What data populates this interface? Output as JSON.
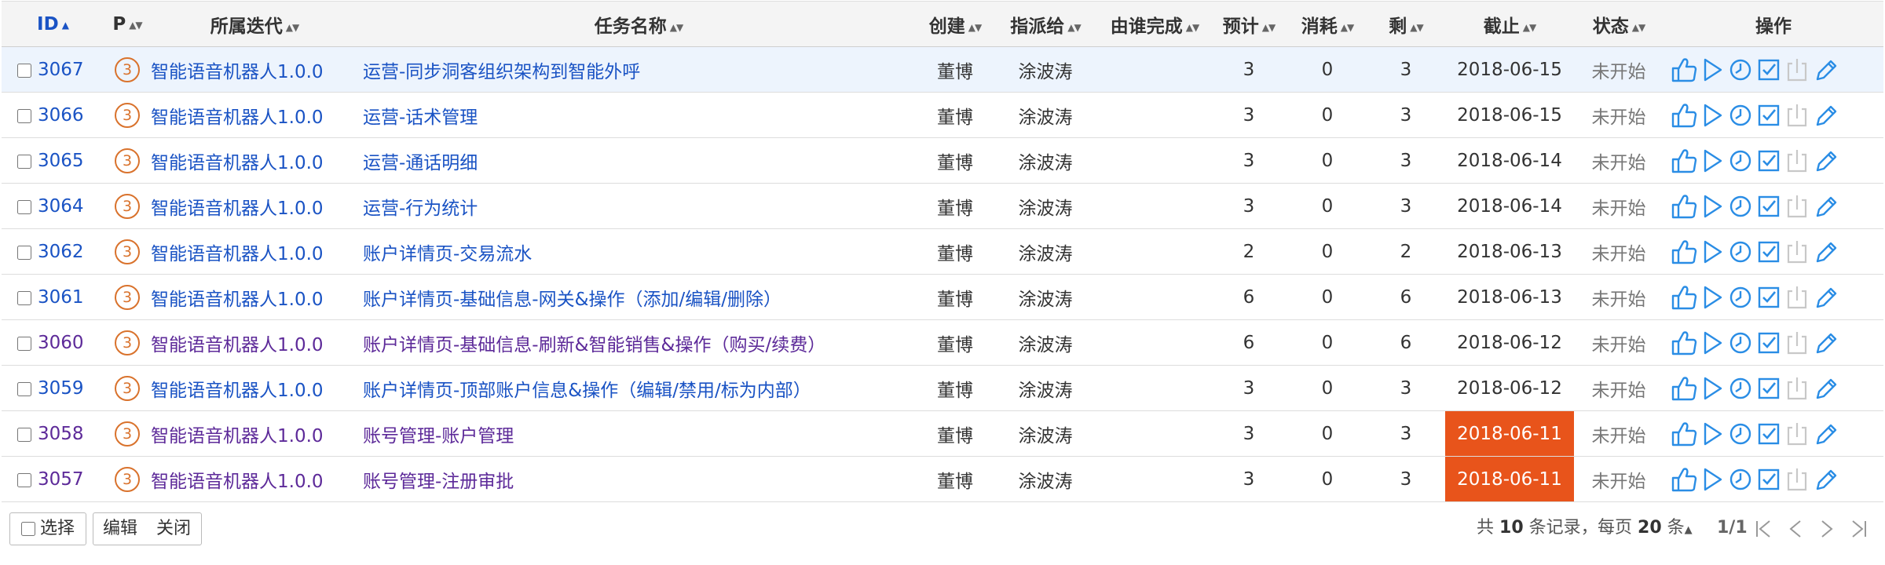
{
  "colors": {
    "link": "#1a53c4",
    "link_visited": "#5d2a99",
    "priority": "#d9722c",
    "overdue": "#e8541b",
    "icon": "#2a8de5",
    "icon_disabled": "#c8c8c8",
    "row_highlight": "#edf4fd"
  },
  "headers": {
    "id": "ID",
    "pri": "P",
    "iteration": "所属迭代",
    "name": "任务名称",
    "creator": "创建",
    "assignee": "指派给",
    "finisher": "由谁完成",
    "estimate": "预计",
    "consumed": "消耗",
    "left": "剩",
    "deadline": "截止",
    "status": "状态",
    "actions": "操作"
  },
  "rows": [
    {
      "id": "3067",
      "pri": "3",
      "iteration": "智能语音机器人1.0.0",
      "name": "运营-同步洞客组织架构到智能外呼",
      "creator": "董博",
      "assignee": "涂波涛",
      "finisher": "",
      "estimate": "3",
      "consumed": "0",
      "left": "3",
      "deadline": "2018-06-15",
      "status": "未开始",
      "overdue": false,
      "visited": false,
      "highlight": true
    },
    {
      "id": "3066",
      "pri": "3",
      "iteration": "智能语音机器人1.0.0",
      "name": "运营-话术管理",
      "creator": "董博",
      "assignee": "涂波涛",
      "finisher": "",
      "estimate": "3",
      "consumed": "0",
      "left": "3",
      "deadline": "2018-06-15",
      "status": "未开始",
      "overdue": false,
      "visited": false,
      "highlight": false
    },
    {
      "id": "3065",
      "pri": "3",
      "iteration": "智能语音机器人1.0.0",
      "name": "运营-通话明细",
      "creator": "董博",
      "assignee": "涂波涛",
      "finisher": "",
      "estimate": "3",
      "consumed": "0",
      "left": "3",
      "deadline": "2018-06-14",
      "status": "未开始",
      "overdue": false,
      "visited": false,
      "highlight": false
    },
    {
      "id": "3064",
      "pri": "3",
      "iteration": "智能语音机器人1.0.0",
      "name": "运营-行为统计",
      "creator": "董博",
      "assignee": "涂波涛",
      "finisher": "",
      "estimate": "3",
      "consumed": "0",
      "left": "3",
      "deadline": "2018-06-14",
      "status": "未开始",
      "overdue": false,
      "visited": false,
      "highlight": false
    },
    {
      "id": "3062",
      "pri": "3",
      "iteration": "智能语音机器人1.0.0",
      "name": "账户详情页-交易流水",
      "creator": "董博",
      "assignee": "涂波涛",
      "finisher": "",
      "estimate": "2",
      "consumed": "0",
      "left": "2",
      "deadline": "2018-06-13",
      "status": "未开始",
      "overdue": false,
      "visited": false,
      "highlight": false
    },
    {
      "id": "3061",
      "pri": "3",
      "iteration": "智能语音机器人1.0.0",
      "name": "账户详情页-基础信息-网关&操作（添加/编辑/删除）",
      "creator": "董博",
      "assignee": "涂波涛",
      "finisher": "",
      "estimate": "6",
      "consumed": "0",
      "left": "6",
      "deadline": "2018-06-13",
      "status": "未开始",
      "overdue": false,
      "visited": false,
      "highlight": false
    },
    {
      "id": "3060",
      "pri": "3",
      "iteration": "智能语音机器人1.0.0",
      "name": "账户详情页-基础信息-刷新&智能销售&操作（购买/续费）",
      "creator": "董博",
      "assignee": "涂波涛",
      "finisher": "",
      "estimate": "6",
      "consumed": "0",
      "left": "6",
      "deadline": "2018-06-12",
      "status": "未开始",
      "overdue": false,
      "visited": true,
      "highlight": false
    },
    {
      "id": "3059",
      "pri": "3",
      "iteration": "智能语音机器人1.0.0",
      "name": "账户详情页-顶部账户信息&操作（编辑/禁用/标为内部）",
      "creator": "董博",
      "assignee": "涂波涛",
      "finisher": "",
      "estimate": "3",
      "consumed": "0",
      "left": "3",
      "deadline": "2018-06-12",
      "status": "未开始",
      "overdue": false,
      "visited": false,
      "highlight": false
    },
    {
      "id": "3058",
      "pri": "3",
      "iteration": "智能语音机器人1.0.0",
      "name": "账号管理-账户管理",
      "creator": "董博",
      "assignee": "涂波涛",
      "finisher": "",
      "estimate": "3",
      "consumed": "0",
      "left": "3",
      "deadline": "2018-06-11",
      "status": "未开始",
      "overdue": true,
      "visited": true,
      "highlight": false
    },
    {
      "id": "3057",
      "pri": "3",
      "iteration": "智能语音机器人1.0.0",
      "name": "账号管理-注册审批",
      "creator": "董博",
      "assignee": "涂波涛",
      "finisher": "",
      "estimate": "3",
      "consumed": "0",
      "left": "3",
      "deadline": "2018-06-11",
      "status": "未开始",
      "overdue": true,
      "visited": true,
      "highlight": false
    }
  ],
  "row_actions": [
    {
      "name": "assign",
      "icon": "thumbs-up-icon",
      "enabled": true
    },
    {
      "name": "start",
      "icon": "play-icon",
      "enabled": true
    },
    {
      "name": "record-effort",
      "icon": "clock-icon",
      "enabled": true
    },
    {
      "name": "finish",
      "icon": "checkbox-icon",
      "enabled": true
    },
    {
      "name": "close",
      "icon": "export-icon",
      "enabled": false
    },
    {
      "name": "edit",
      "icon": "pencil-icon",
      "enabled": true
    }
  ],
  "footer": {
    "select_label": "选择",
    "edit_label": "编辑",
    "close_label": "关闭",
    "pager_prefix": "共",
    "total": "10",
    "pager_records": "条记录，",
    "per_page_label": "每页",
    "per_page": "20",
    "per_page_unit": "条",
    "page_info": "1/1"
  }
}
